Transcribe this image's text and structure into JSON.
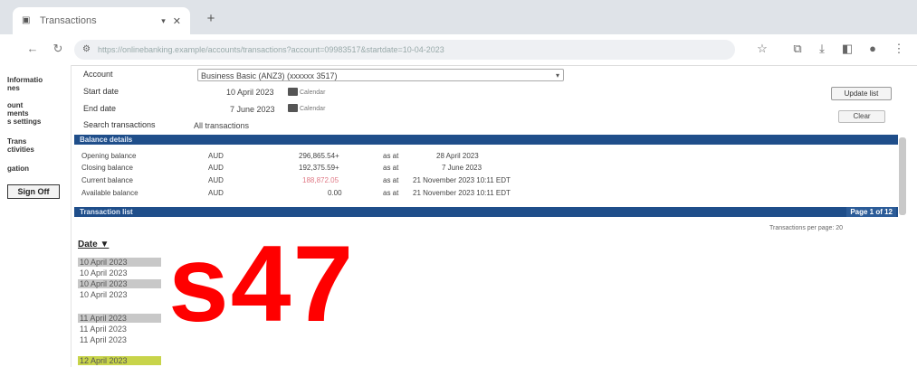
{
  "browser": {
    "tab_title": "Transactions",
    "tab_icon": "bank-favicon-icon",
    "address_text": "https://onlinebanking.example/accounts/transactions?account=09983517&startdate=10-04-2023"
  },
  "left_nav": {
    "items": [
      "Informatio\nnes",
      "ount\nments\ns settings",
      "Trans\nctivities",
      "gation"
    ],
    "sign_off": "Sign Off"
  },
  "filters": {
    "account_label": "Account",
    "account_value": "Business Basic (ANZ3) (xxxxxx 3517)",
    "start_label": "Start date",
    "start_value": "10 April 2023",
    "end_label": "End date",
    "end_value": "7 June 2023",
    "calendar_label": "Calendar",
    "search_label": "Search transactions",
    "search_value": "All transactions",
    "update_label": "Update list",
    "clear_label": "Clear"
  },
  "balance": {
    "header": "Balance details",
    "rows": [
      {
        "label": "Opening balance",
        "currency": "AUD",
        "amount": "296,865.54+",
        "as_of": "as at",
        "when": "28 April 2023"
      },
      {
        "label": "Closing balance",
        "currency": "AUD",
        "amount": "192,375.59+",
        "as_of": "as at",
        "when": "7 June 2023"
      },
      {
        "label": "Current balance",
        "currency": "AUD",
        "amount": "188,872.05",
        "as_of": "as at",
        "when": "21 November 2023 10:11 EDT"
      },
      {
        "label": "Available balance",
        "currency": "AUD",
        "amount": "0.00",
        "as_of": "as at",
        "when": "21 November 2023 10:11 EDT"
      }
    ]
  },
  "transactions": {
    "header": "Transaction list",
    "pager": "Page 1 of 12",
    "rows_per_page": "Transactions per page: 20",
    "date_header": "Date",
    "dates": [
      "10 April 2023",
      "10 April 2023",
      "10 April 2023",
      "10 April 2023",
      "11 April 2023",
      "11 April 2023",
      "11 April 2023",
      "12 April 2023"
    ]
  },
  "overlay_text": "s47",
  "colors": {
    "section_bar": "#1f4e8a",
    "overlay": "#ff0000",
    "highlight_row": "#c8d44a"
  }
}
